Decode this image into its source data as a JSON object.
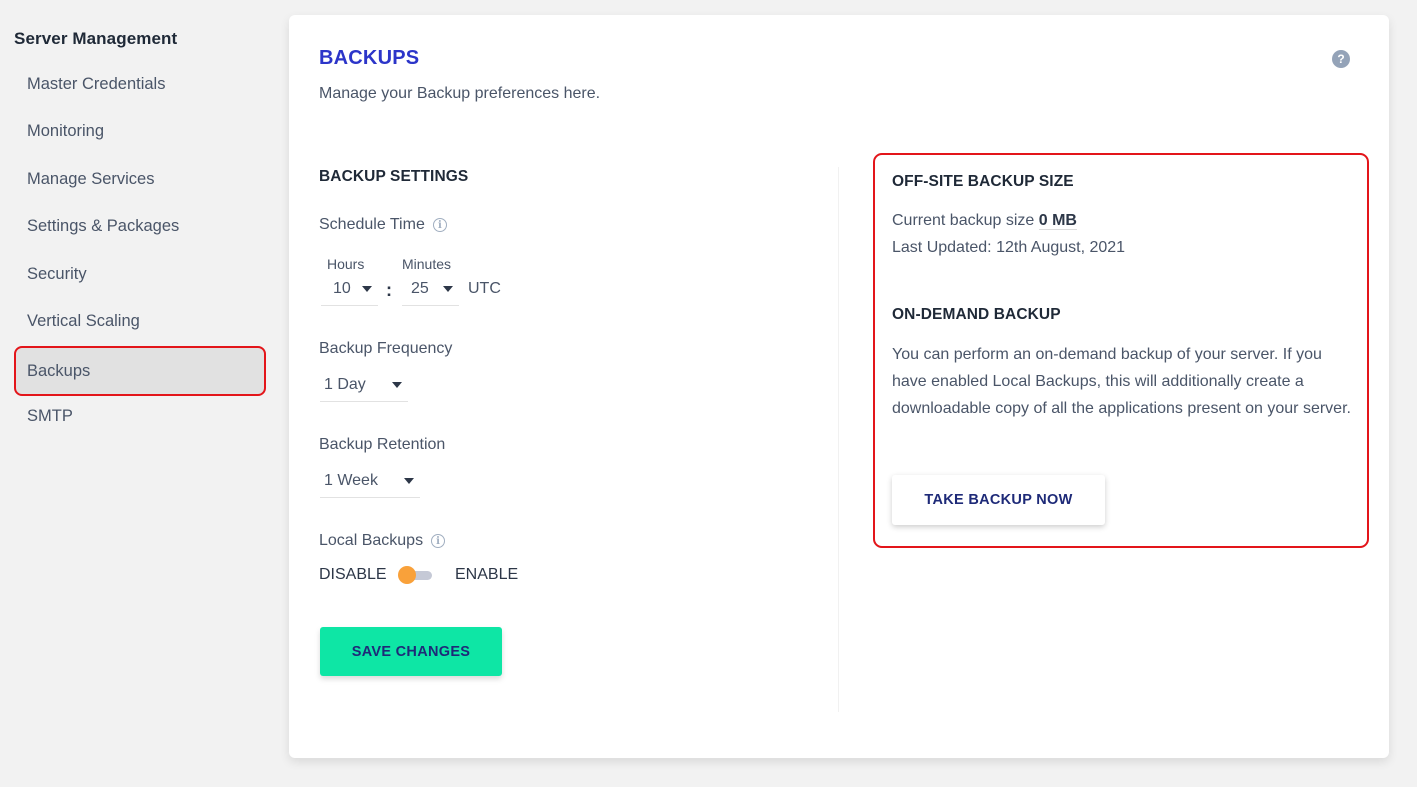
{
  "sidebar": {
    "title": "Server Management",
    "items": [
      {
        "label": "Master Credentials"
      },
      {
        "label": "Monitoring"
      },
      {
        "label": "Manage Services"
      },
      {
        "label": "Settings & Packages"
      },
      {
        "label": "Security"
      },
      {
        "label": "Vertical Scaling"
      },
      {
        "label": "Backups",
        "active": true
      },
      {
        "label": "SMTP"
      }
    ]
  },
  "page": {
    "title": "BACKUPS",
    "subtitle": "Manage your Backup preferences here.",
    "help_icon": "?"
  },
  "settings": {
    "section_title": "BACKUP SETTINGS",
    "schedule_time": {
      "label": "Schedule Time",
      "hours_label": "Hours",
      "hours_value": "10",
      "separator": ":",
      "minutes_label": "Minutes",
      "minutes_value": "25",
      "timezone": "UTC"
    },
    "frequency": {
      "label": "Backup Frequency",
      "value": "1 Day"
    },
    "retention": {
      "label": "Backup Retention",
      "value": "1 Week"
    },
    "local_backups": {
      "label": "Local Backups",
      "off_label": "DISABLE",
      "on_label": "ENABLE",
      "enabled": false
    },
    "save_label": "SAVE CHANGES"
  },
  "offsite": {
    "title": "OFF-SITE BACKUP SIZE",
    "size_prefix": "Current backup size",
    "size_value": "0 MB",
    "last_updated": "Last Updated: 12th August, 2021"
  },
  "on_demand": {
    "title": "ON-DEMAND BACKUP",
    "description": "You can perform an on-demand backup of your server. If you have enabled Local Backups, this will additionally create a downloadable copy of all the applications present on your server.",
    "button_label": "TAKE BACKUP NOW"
  },
  "colors": {
    "accent_title": "#2c35c9",
    "save_button": "#0ee6a5",
    "toggle_knob": "#f9a13a",
    "highlight_border": "#e3151a"
  }
}
